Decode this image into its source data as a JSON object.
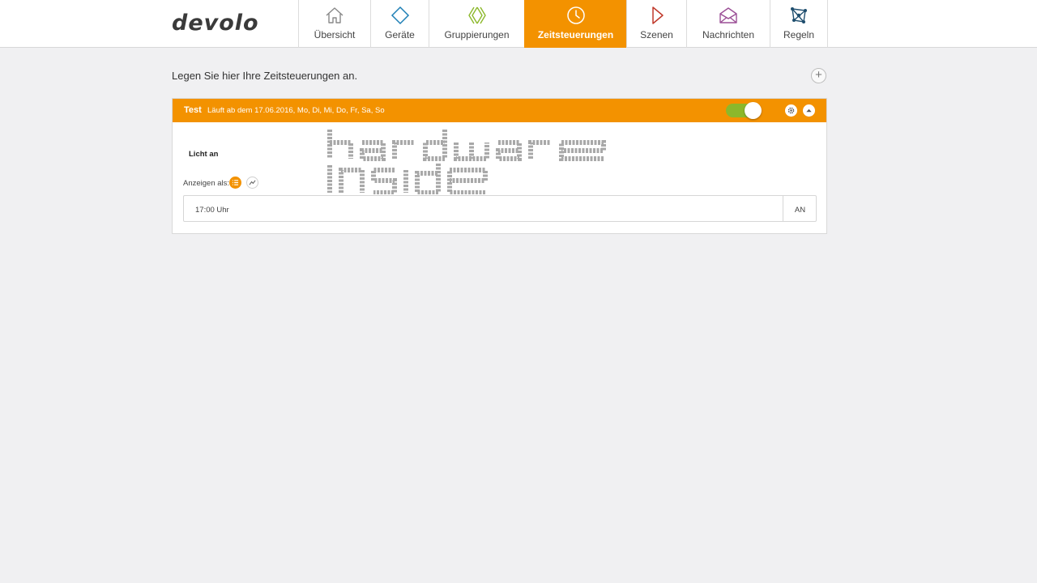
{
  "header": {
    "logo_text": "devolo",
    "nav": [
      {
        "label": "Übersicht",
        "icon": "home-icon",
        "color": "#888888"
      },
      {
        "label": "Geräte",
        "icon": "device-diamond-icon",
        "color": "#1e7fb5"
      },
      {
        "label": "Gruppierungen",
        "icon": "group-chevrons-icon",
        "color": "#8cb82b"
      },
      {
        "label": "Zeitsteuerungen",
        "icon": "clock-icon",
        "color": "#ffffff",
        "active": true
      },
      {
        "label": "Szenen",
        "icon": "play-triangle-icon",
        "color": "#c0392b"
      },
      {
        "label": "Nachrichten",
        "icon": "envelope-icon",
        "color": "#9b4f96"
      },
      {
        "label": "Regeln",
        "icon": "rules-network-icon",
        "color": "#1f4e6e"
      }
    ]
  },
  "main": {
    "intro": "Legen Sie hier Ihre Zeitsteuerungen an.",
    "add_label": "+",
    "schedule": {
      "title": "Test",
      "subtitle": "Läuft ab dem 17.06.2016, Mo, Di, Mi, Do, Fr, Sa, So",
      "enabled": true,
      "action_label": "Licht an",
      "view_label": "Anzeigen als:",
      "entries": [
        {
          "time": "17:00 Uhr",
          "state": "AN"
        }
      ]
    }
  },
  "watermark_text": "hardware inside",
  "colors": {
    "accent": "#f39200",
    "toggle_on": "#8cb82b",
    "background": "#f0f0f2"
  }
}
